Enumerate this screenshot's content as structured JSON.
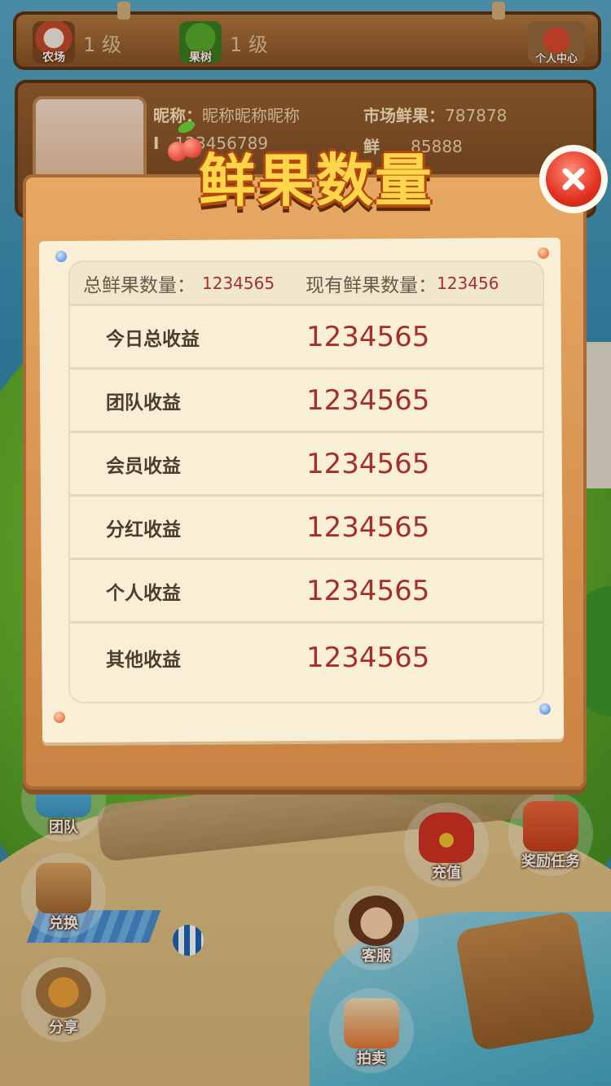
{
  "topbar": {
    "farm_label": "农场",
    "farm_level": "1 级",
    "fruit_tree_label": "果树",
    "fruit_tree_level": "1 级",
    "personal_center_label": "个人中心"
  },
  "user": {
    "nickname_label": "昵称：",
    "nickname": "昵称昵称昵称",
    "market_fruit_label": "市场鲜果：",
    "market_fruit": "787878",
    "id_label": "I",
    "id_value": "123456789",
    "fresh_label": "鲜",
    "fresh_value": "85888"
  },
  "modal": {
    "title": "鲜果数量",
    "total_label": "总鲜果数量：",
    "total_value": "1234565",
    "current_label": "现有鲜果数量：",
    "current_value": "123456",
    "rows": [
      {
        "label": "今日总收益",
        "value": "1234565"
      },
      {
        "label": "团队收益",
        "value": "1234565"
      },
      {
        "label": "会员收益",
        "value": "1234565"
      },
      {
        "label": "分红收益",
        "value": "1234565"
      },
      {
        "label": "个人收益",
        "value": "1234565"
      },
      {
        "label": "其他收益",
        "value": "1234565"
      }
    ]
  },
  "bottom_buttons": {
    "team": "团队",
    "exchange": "兑换",
    "share": "分享",
    "recharge": "充值",
    "reward_task": "奖励任务",
    "customer_service": "客服",
    "auction": "拍卖"
  },
  "colors": {
    "accent_value": "#a3302a",
    "board_wood": "#d6914d",
    "title_yellow": "#ffd64a",
    "close_red": "#e2321f"
  }
}
